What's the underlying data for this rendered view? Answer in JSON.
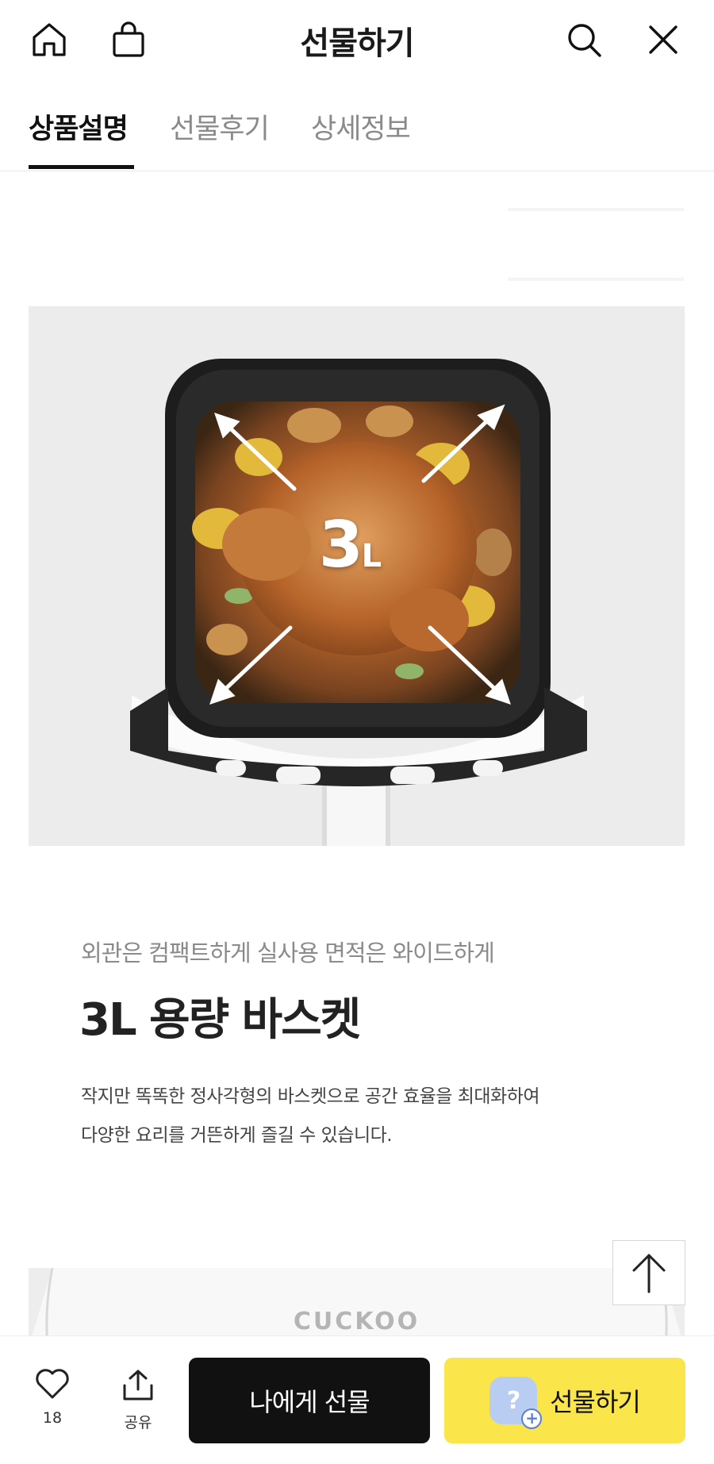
{
  "header": {
    "title": "선물하기",
    "icons": {
      "home": "home-icon",
      "bag": "shopping-bag-icon",
      "search": "search-icon",
      "close": "close-icon"
    }
  },
  "tabs": [
    {
      "label": "상품설명",
      "active": true
    },
    {
      "label": "선물후기",
      "active": false
    },
    {
      "label": "상세정보",
      "active": false
    }
  ],
  "product_image": {
    "capacity_number": "3",
    "capacity_unit": "L"
  },
  "content": {
    "subheading": "외관은 컴팩트하게 실사용 면적은 와이드하게",
    "heading": "3L 용량 바스켓",
    "description_line1": "작지만 똑똑한 정사각형의 바스켓으로 공간 효율을 최대화하여",
    "description_line2": "다양한 요리를 거뜬하게 즐길 수 있습니다."
  },
  "second_image": {
    "brand": "CUCKOO"
  },
  "bottom_bar": {
    "like_count": "18",
    "share_label": "공유",
    "self_gift_label": "나에게 선물",
    "gift_label": "선물하기"
  },
  "colors": {
    "accent_yellow": "#fae64a",
    "dark_button": "#111111",
    "active_tab": "#111111"
  }
}
